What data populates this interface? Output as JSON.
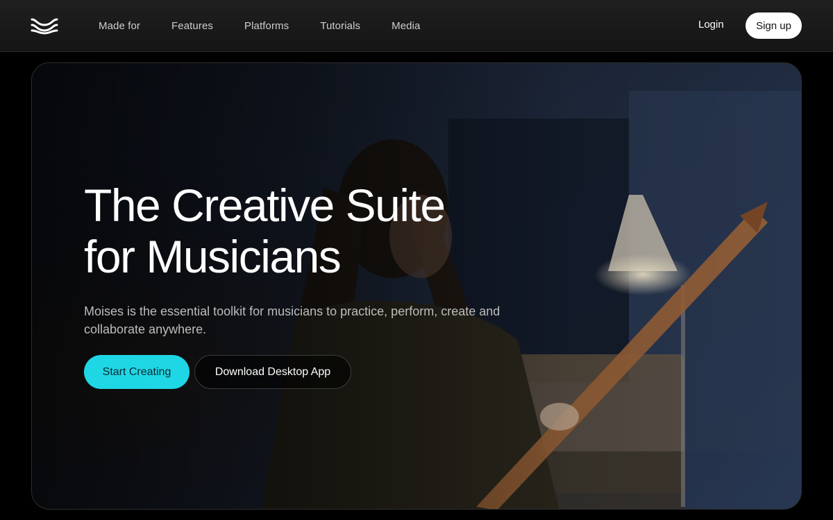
{
  "brand": {
    "logo_icon": "moises-waves-icon"
  },
  "nav": {
    "items": [
      {
        "label": "Made for"
      },
      {
        "label": "Features"
      },
      {
        "label": "Platforms"
      },
      {
        "label": "Tutorials"
      },
      {
        "label": "Media"
      }
    ]
  },
  "auth": {
    "login_label": "Login",
    "signup_label": "Sign up"
  },
  "hero": {
    "headline_line1": "The Creative Suite",
    "headline_line2": "for Musicians",
    "subtext": "Moises is the essential toolkit for musicians to practice, perform, create and collaborate anywhere.",
    "primary_cta": "Start Creating",
    "secondary_cta": "Download Desktop App"
  },
  "colors": {
    "accent": "#1fd6e4",
    "header_bg": "#1a1a1a",
    "page_bg": "#000000"
  }
}
